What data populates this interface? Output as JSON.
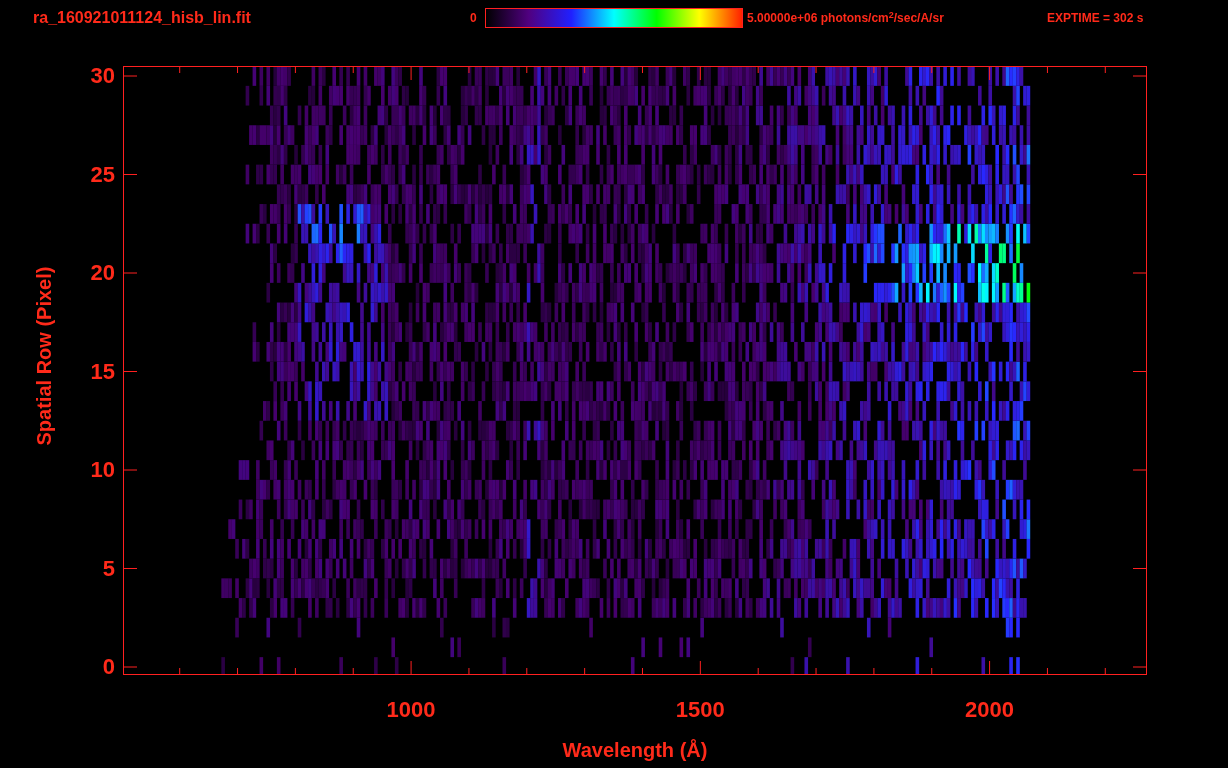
{
  "title": "ra_160921011124_hisb_lin.fit",
  "colorbar": {
    "min_label": "0",
    "max_label": "5.00000e+06 photons/cm$^{2}$/sec/A/sr"
  },
  "exposure": "EXPTIME = 302 s",
  "plot": {
    "ylabel": "Spatial Row (Pixel)",
    "xlabel": "Wavelength (Å)",
    "yticks": [
      "30",
      "25",
      "20",
      "15",
      "10",
      "5",
      "0"
    ],
    "xticks": [
      "1000",
      "1500",
      "2000"
    ]
  }
}
